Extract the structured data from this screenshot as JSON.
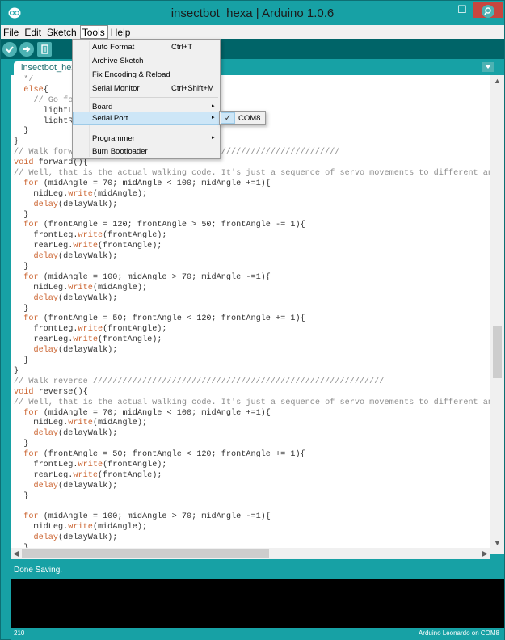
{
  "window": {
    "title": "insectbot_hexa | Arduino 1.0.6",
    "minimize_glyph": "–",
    "maximize_glyph": "☐",
    "close_glyph": "✕"
  },
  "menubar": {
    "items": [
      "File",
      "Edit",
      "Sketch",
      "Tools",
      "Help"
    ]
  },
  "toolbar": {
    "buttons": [
      "verify-icon",
      "upload-icon",
      "new-icon",
      "open-icon",
      "save-icon"
    ],
    "serial_monitor_icon": "magnifier-icon"
  },
  "tabs": {
    "active": "insectbot_hexa"
  },
  "tools_menu": {
    "items": [
      {
        "label": "Auto Format",
        "shortcut": "Ctrl+T"
      },
      {
        "label": "Archive Sketch",
        "shortcut": ""
      },
      {
        "label": "Fix Encoding & Reload",
        "shortcut": ""
      },
      {
        "label": "Serial Monitor",
        "shortcut": "Ctrl+Shift+M"
      },
      {
        "label": "Board",
        "shortcut": ""
      },
      {
        "label": "Serial Port",
        "shortcut": ""
      },
      {
        "label": "Programmer",
        "shortcut": ""
      },
      {
        "label": "Burn Bootloader",
        "shortcut": ""
      }
    ],
    "submenu_arrow": "▸"
  },
  "serial_port_submenu": {
    "selected": "COM8",
    "check": "✓"
  },
  "code": [
    "  */",
    "  else{",
    "    // Go for",
    "      lightLe",
    "      lightRi",
    "  }",
    "}",
    "// Walk forwa                          ///////////////////////////",
    "void forward(){",
    "// Well, that is the actual walking code. It's just a sequence of servo movements to different angles",
    "  for (midAngle = 70; midAngle < 100; midAngle +=1){",
    "    midLeg.write(midAngle);",
    "    delay(delayWalk);",
    "  }",
    "  for (frontAngle = 120; frontAngle > 50; frontAngle -= 1){",
    "    frontLeg.write(frontAngle);",
    "    rearLeg.write(frontAngle);",
    "    delay(delayWalk);",
    "  }",
    "  for (midAngle = 100; midAngle > 70; midAngle -=1){",
    "    midLeg.write(midAngle);",
    "    delay(delayWalk);",
    "  }",
    "  for (frontAngle = 50; frontAngle < 120; frontAngle += 1){",
    "    frontLeg.write(frontAngle);",
    "    rearLeg.write(frontAngle);",
    "    delay(delayWalk);",
    "  }",
    "}",
    "// Walk reverse ///////////////////////////////////////////////////////////",
    "void reverse(){",
    "// Well, that is the actual walking code. It's just a sequence of servo movements to different angles",
    "  for (midAngle = 70; midAngle < 100; midAngle +=1){",
    "    midLeg.write(midAngle);",
    "    delay(delayWalk);",
    "  }",
    "  for (frontAngle = 50; frontAngle < 120; frontAngle += 1){",
    "    frontLeg.write(frontAngle);",
    "    rearLeg.write(frontAngle);",
    "    delay(delayWalk);",
    "  }",
    "",
    "  for (midAngle = 100; midAngle > 70; midAngle -=1){",
    "    midLeg.write(midAngle);",
    "    delay(delayWalk);",
    "  }"
  ],
  "status": {
    "message": "Done Saving.",
    "line_number": "210",
    "board": "Arduino Leonardo on COM8"
  },
  "colors": {
    "teal": "#17a1a5",
    "toolbar_dark": "#006468",
    "keyword": "#cc6633",
    "comment": "#8d8d8d",
    "close_red": "#c8463f"
  }
}
